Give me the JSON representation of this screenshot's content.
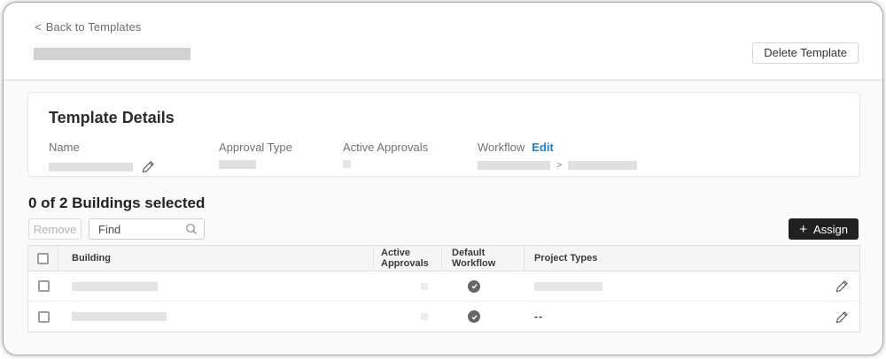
{
  "window": {
    "back_chevron": "<",
    "back_link": "Back to Templates",
    "delete_button": "Delete Template"
  },
  "template_details": {
    "title": "Template Details",
    "fields": [
      {
        "label": "Name"
      },
      {
        "label": "Approval Type"
      },
      {
        "label": "Active Approvals"
      },
      {
        "label": "Workflow",
        "action": "Edit"
      }
    ],
    "workflow_separator": ">"
  },
  "buildings": {
    "heading": "0 of 2 Buildings selected",
    "remove_button": "Remove",
    "find_placeholder": "Find",
    "assign_plus": "+",
    "assign_button": "Assign",
    "table": {
      "columns": [
        "Building",
        "Active Approvals",
        "Default Workflow",
        "Project Types"
      ],
      "rows": [
        {
          "default_workflow": "checked",
          "project_types": ""
        },
        {
          "default_workflow": "checked",
          "project_types": "--"
        }
      ]
    }
  },
  "colors": {
    "accent_blue": "#1b7fd2",
    "assign_black": "#202020",
    "check_circle": "#666666",
    "placeholder_gray": "#e0e0e0"
  }
}
